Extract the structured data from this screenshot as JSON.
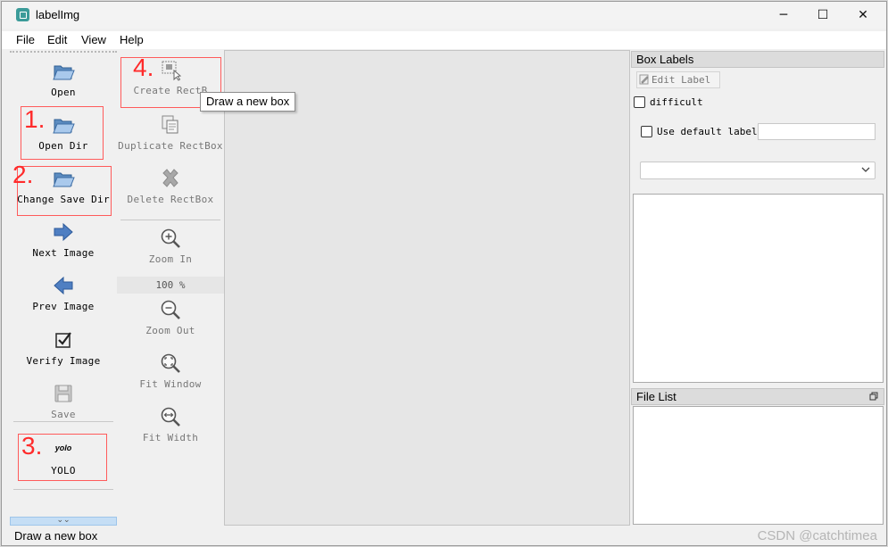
{
  "window": {
    "title": "labelImg",
    "controls": {
      "minimize": "─",
      "maximize": "☐",
      "close": "✕"
    }
  },
  "menu": [
    "File",
    "Edit",
    "View",
    "Help"
  ],
  "toolbar_left": [
    {
      "label": "Open",
      "icon": "folder-open-icon"
    },
    {
      "label": "Open Dir",
      "icon": "folder-open-icon"
    },
    {
      "label": "Change Save Dir",
      "icon": "folder-open-icon"
    },
    {
      "label": "Next Image",
      "icon": "arrow-right-icon"
    },
    {
      "label": "Prev Image",
      "icon": "arrow-left-icon"
    },
    {
      "label": "Verify Image",
      "icon": "checkbox-verify-icon"
    },
    {
      "label": "Save",
      "icon": "floppy-disk-icon",
      "disabled": true
    },
    {
      "label": "YOLO",
      "icon_text": "yolo"
    }
  ],
  "toolbar_right": [
    {
      "label": "Create RectB",
      "icon": "create-rectbox-icon",
      "disabled": true
    },
    {
      "label": "Duplicate RectBox",
      "icon": "duplicate-rectbox-icon",
      "disabled": true
    },
    {
      "label": "Delete RectBox",
      "icon": "delete-x-icon",
      "disabled": true
    },
    {
      "label": "Zoom In",
      "icon": "zoom-in-icon",
      "disabled": true
    },
    {
      "label": "Zoom Out",
      "icon": "zoom-out-icon",
      "disabled": true
    },
    {
      "label": "Fit Window",
      "icon": "fit-window-icon",
      "disabled": true
    },
    {
      "label": "Fit Width",
      "icon": "fit-width-icon",
      "disabled": true
    }
  ],
  "zoom_value": "100 %",
  "annotations": [
    "1.",
    "2.",
    "3.",
    "4."
  ],
  "tooltip": "Draw a new box",
  "box_labels": {
    "title": "Box Labels",
    "edit_label_button": "Edit Label",
    "difficult_label": "difficult",
    "use_default_label": "Use default label",
    "default_label_value": "",
    "combo_value": ""
  },
  "file_list": {
    "title": "File List"
  },
  "status": "Draw a new box",
  "watermark": "CSDN @catchtimea",
  "colors": {
    "annotation_red": "#ff2b2b",
    "canvas": "#e6e6e6",
    "expand_button": "#c5def5"
  }
}
